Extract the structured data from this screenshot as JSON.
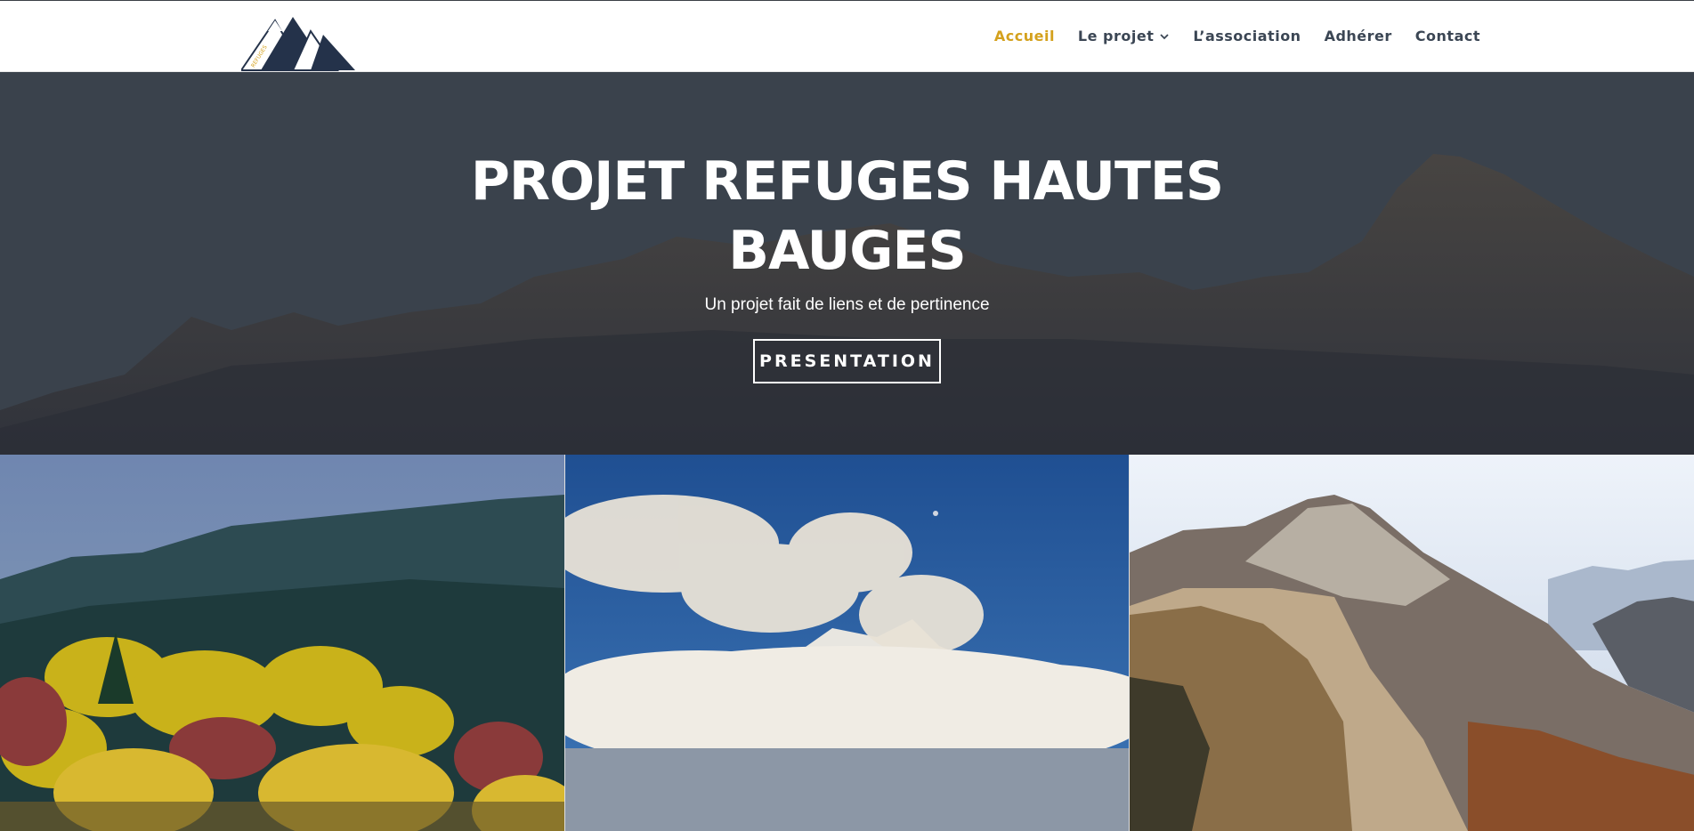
{
  "header": {
    "logo_icon": "mountain-logo",
    "nav": [
      {
        "label": "Accueil",
        "active": true
      },
      {
        "label": "Le projet",
        "has_dropdown": true
      },
      {
        "label": "L’association"
      },
      {
        "label": "Adhérer"
      },
      {
        "label": "Contact"
      }
    ]
  },
  "hero": {
    "title_line1": "PROJET REFUGES HAUTES",
    "title_line2": "BAUGES",
    "subtitle": "Un projet fait de liens et de pertinence",
    "button_label": "PRESENTATION"
  },
  "colors": {
    "accent": "#d4a11d",
    "nav_text": "#3b4654",
    "hero_overlay": "#3a424c"
  },
  "gallery": [
    {
      "name": "autumn-forest-photo"
    },
    {
      "name": "cloud-summit-photo"
    },
    {
      "name": "rocky-peaks-photo"
    }
  ]
}
